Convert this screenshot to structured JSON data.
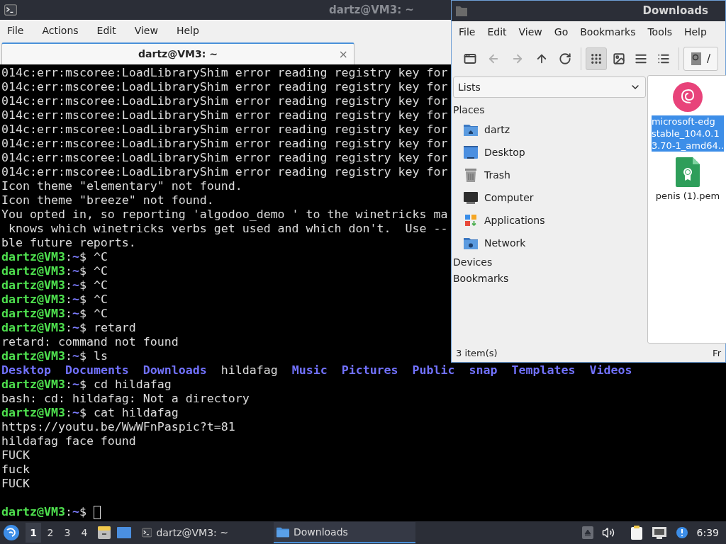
{
  "terminal_window": {
    "title": "dartz@VM3: ~",
    "active": false,
    "menu": [
      "File",
      "Actions",
      "Edit",
      "View",
      "Help"
    ],
    "tabs": [
      {
        "label": "dartz@VM3: ~",
        "selected": true,
        "close": "×"
      }
    ],
    "lines": [
      {
        "kind": "output",
        "text": "014c:err:mscoree:LoadLibraryShim error reading registry key for"
      },
      {
        "kind": "output",
        "text": "014c:err:mscoree:LoadLibraryShim error reading registry key for"
      },
      {
        "kind": "output",
        "text": "014c:err:mscoree:LoadLibraryShim error reading registry key for"
      },
      {
        "kind": "output",
        "text": "014c:err:mscoree:LoadLibraryShim error reading registry key for"
      },
      {
        "kind": "output",
        "text": "014c:err:mscoree:LoadLibraryShim error reading registry key for"
      },
      {
        "kind": "output",
        "text": "014c:err:mscoree:LoadLibraryShim error reading registry key for"
      },
      {
        "kind": "output",
        "text": "014c:err:mscoree:LoadLibraryShim error reading registry key for"
      },
      {
        "kind": "output",
        "text": "014c:err:mscoree:LoadLibraryShim error reading registry key for"
      },
      {
        "kind": "output",
        "text": "Icon theme \"elementary\" not found."
      },
      {
        "kind": "output",
        "text": "Icon theme \"breeze\" not found."
      },
      {
        "kind": "output",
        "text": "You opted in, so reporting 'algodoo_demo ' to the winetricks ma"
      },
      {
        "kind": "output",
        "text": " knows which winetricks verbs get used and which don't.  Use --"
      },
      {
        "kind": "output",
        "text": "ble future reports."
      },
      {
        "kind": "prompt",
        "user": "dartz@VM3",
        "sep": ":",
        "path": "~",
        "symbol": "$",
        "command": "^C"
      },
      {
        "kind": "prompt",
        "user": "dartz@VM3",
        "sep": ":",
        "path": "~",
        "symbol": "$",
        "command": "^C"
      },
      {
        "kind": "prompt",
        "user": "dartz@VM3",
        "sep": ":",
        "path": "~",
        "symbol": "$",
        "command": "^C"
      },
      {
        "kind": "prompt",
        "user": "dartz@VM3",
        "sep": ":",
        "path": "~",
        "symbol": "$",
        "command": "^C"
      },
      {
        "kind": "prompt",
        "user": "dartz@VM3",
        "sep": ":",
        "path": "~",
        "symbol": "$",
        "command": "^C"
      },
      {
        "kind": "prompt",
        "user": "dartz@VM3",
        "sep": ":",
        "path": "~",
        "symbol": "$",
        "command": "retard"
      },
      {
        "kind": "output",
        "text": "retard: command not found"
      },
      {
        "kind": "prompt",
        "user": "dartz@VM3",
        "sep": ":",
        "path": "~",
        "symbol": "$",
        "command": "ls"
      },
      {
        "kind": "listing",
        "entries": [
          {
            "name": "Desktop",
            "kind": "dir"
          },
          {
            "name": "Documents",
            "kind": "dir"
          },
          {
            "name": "Downloads",
            "kind": "dir"
          },
          {
            "name": "hildafag",
            "kind": "file"
          },
          {
            "name": "Music",
            "kind": "dir"
          },
          {
            "name": "Pictures",
            "kind": "dir"
          },
          {
            "name": "Public",
            "kind": "dir"
          },
          {
            "name": "snap",
            "kind": "dir"
          },
          {
            "name": "Templates",
            "kind": "dir"
          },
          {
            "name": "Videos",
            "kind": "dir"
          }
        ]
      },
      {
        "kind": "prompt",
        "user": "dartz@VM3",
        "sep": ":",
        "path": "~",
        "symbol": "$",
        "command": "cd hildafag"
      },
      {
        "kind": "output",
        "text": "bash: cd: hildafag: Not a directory"
      },
      {
        "kind": "prompt",
        "user": "dartz@VM3",
        "sep": ":",
        "path": "~",
        "symbol": "$",
        "command": "cat hildafag"
      },
      {
        "kind": "output",
        "text": "https://youtu.be/WwWFnPaspic?t=81"
      },
      {
        "kind": "output",
        "text": "hildafag face found"
      },
      {
        "kind": "output",
        "text": "FUCK"
      },
      {
        "kind": "output",
        "text": "fuck"
      },
      {
        "kind": "output",
        "text": "FUCK"
      },
      {
        "kind": "blank"
      },
      {
        "kind": "input",
        "user": "dartz@VM3",
        "sep": ":",
        "path": "~",
        "symbol": "$"
      }
    ]
  },
  "file_manager": {
    "title": "Downloads",
    "active": true,
    "menu": [
      "File",
      "Edit",
      "View",
      "Go",
      "Bookmarks",
      "Tools",
      "Help"
    ],
    "nav_buttons": [
      {
        "kind": "new-tab",
        "disabled": false
      },
      {
        "kind": "back",
        "disabled": true
      },
      {
        "kind": "forward",
        "disabled": true
      },
      {
        "kind": "up",
        "disabled": false
      },
      {
        "kind": "reload",
        "disabled": false
      }
    ],
    "view_buttons": [
      {
        "kind": "icons",
        "selected": true
      },
      {
        "kind": "thumbnails",
        "selected": false
      },
      {
        "kind": "compact",
        "selected": false
      },
      {
        "kind": "details",
        "selected": false
      }
    ],
    "path_segment": "/",
    "side_pane_mode": "Lists",
    "sections": [
      {
        "heading": "Places",
        "items": [
          {
            "label": "dartz",
            "kind": "home"
          },
          {
            "label": "Desktop",
            "kind": "desktop"
          },
          {
            "label": "Trash",
            "kind": "trash"
          },
          {
            "label": "Computer",
            "kind": "computer"
          },
          {
            "label": "Applications",
            "kind": "apps"
          },
          {
            "label": "Network",
            "kind": "network"
          }
        ]
      },
      {
        "heading": "Devices"
      },
      {
        "heading": "Bookmarks"
      }
    ],
    "files": [
      {
        "name_lines": [
          "microsoft-edg",
          "stable_104.0.1",
          "3.70-1_amd64.."
        ],
        "kind": "debian",
        "selected": true
      },
      {
        "name_lines": [
          "penis (1).pem"
        ],
        "kind": "certificate",
        "selected": false
      }
    ],
    "status": "3 item(s)",
    "status_right": "Fr"
  },
  "taskbar": {
    "workspaces": [
      {
        "label": "1",
        "selected": true
      },
      {
        "label": "2",
        "selected": false
      },
      {
        "label": "3",
        "selected": false
      },
      {
        "label": "4",
        "selected": false
      }
    ],
    "tasks": [
      {
        "label": "dartz@VM3: ~",
        "kind": "terminal",
        "active": false
      },
      {
        "label": "Downloads",
        "kind": "folder",
        "active": true
      }
    ],
    "clock": "6:39"
  }
}
